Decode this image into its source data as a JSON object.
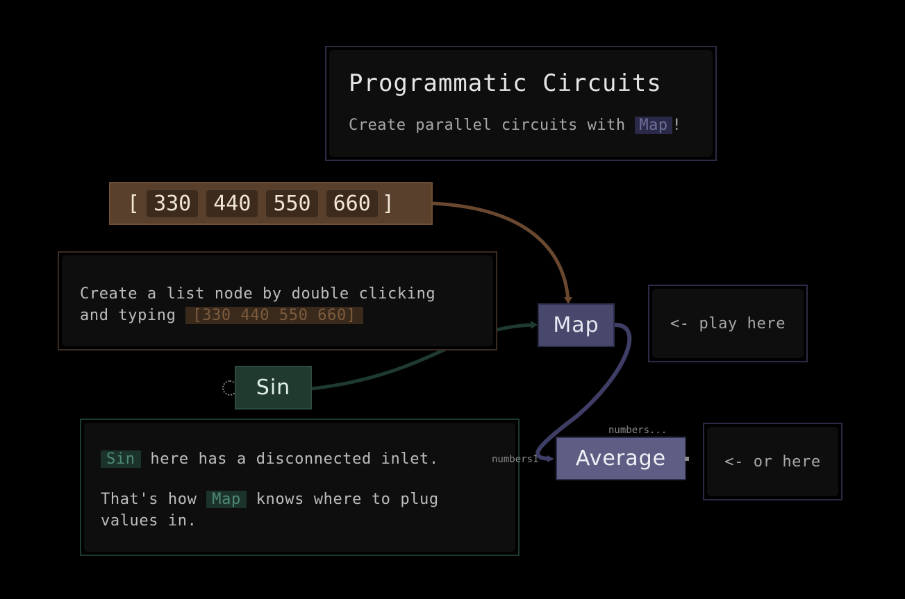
{
  "title_card": {
    "title": "Programmatic Circuits",
    "subtitle_before": "Create parallel circuits with ",
    "subtitle_chip": "Map",
    "subtitle_after": "!"
  },
  "list_node": {
    "open_bracket": "[",
    "values": [
      "330",
      "440",
      "550",
      "660"
    ],
    "close_bracket": "]"
  },
  "list_hint": {
    "line1": "Create a list node by double clicking",
    "line2_before": "and typing ",
    "line2_chip": "[330 440 550 660]"
  },
  "map_node": {
    "label": "Map"
  },
  "play_hint": {
    "text": "<- play here"
  },
  "sin_node": {
    "label": "Sin"
  },
  "sin_hint": {
    "p1_chip": "Sin",
    "p1_rest": " here has a disconnected inlet.",
    "p2_before": "That's how ",
    "p2_chip": "Map",
    "p2_after": " knows where to plug",
    "p2_line2": "values in."
  },
  "average_node": {
    "label": "Average",
    "inlet_label": "numbers1",
    "top_label": "numbers..."
  },
  "or_hint": {
    "text": "<- or here"
  },
  "colors": {
    "list_wire": "#6a4830",
    "sin_wire": "#1f3a30",
    "map_wire": "#3e3e66"
  }
}
